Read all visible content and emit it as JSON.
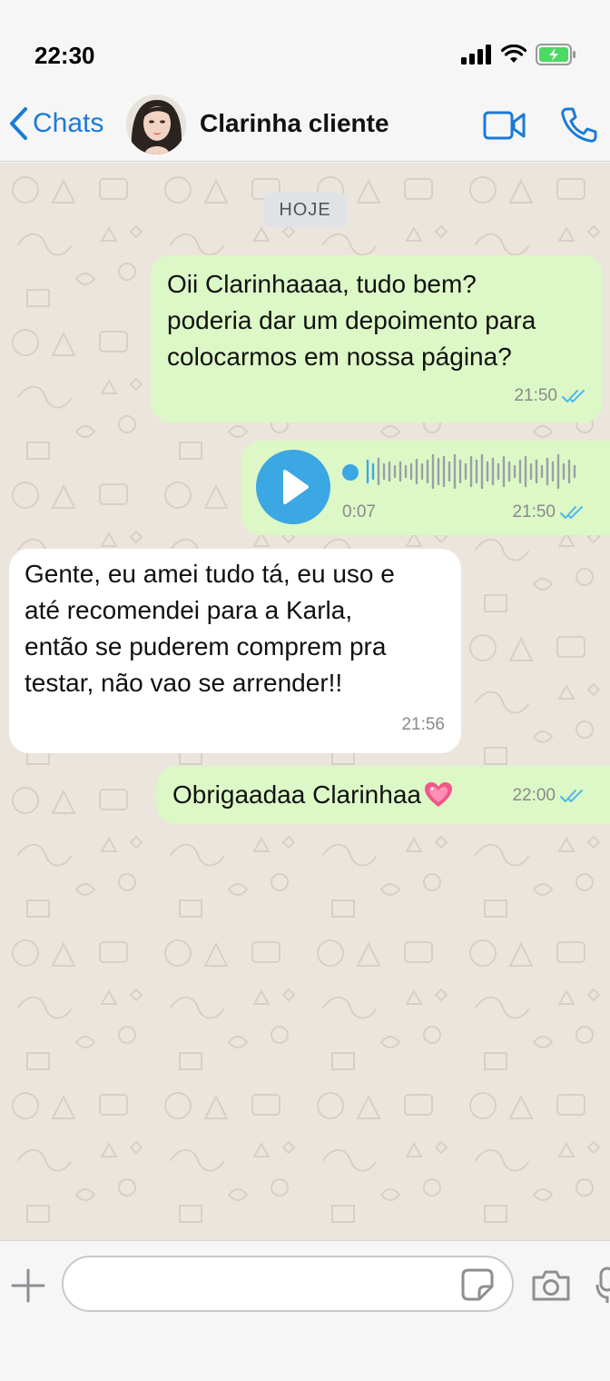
{
  "status_bar": {
    "time": "22:30",
    "icons": [
      "signal-icon",
      "wifi-icon",
      "battery-charging-icon"
    ]
  },
  "header": {
    "back_label": "Chats",
    "contact_name": "Clarinha cliente",
    "icons": [
      "chevron-left-icon",
      "avatar",
      "video-call-icon",
      "phone-call-icon"
    ]
  },
  "chat": {
    "day_label": "HOJE",
    "messages": [
      {
        "direction": "outgoing",
        "lines": [
          "Oii Clarinhaaaa, tudo bem?",
          "poderia dar um depoimento para",
          "colocarmos em nossa página?"
        ],
        "time": "21:50",
        "status": "read-double-check"
      },
      {
        "direction": "outgoing",
        "type": "voice",
        "duration": "0:07",
        "time": "21:50",
        "status": "read-double-check"
      },
      {
        "direction": "incoming",
        "lines": [
          "Gente, eu amei tudo tá, eu uso e",
          "até recomendei para a Karla,",
          "então se puderem comprem pra",
          "testar, não vao se arrender!!"
        ],
        "time": "21:56"
      },
      {
        "direction": "outgoing",
        "text": "Obrigaadaa Clarinhaa",
        "emoji": "sparkling-heart-icon",
        "time": "22:00",
        "status": "read-double-check"
      }
    ]
  },
  "input_bar": {
    "placeholder": "",
    "icons": [
      "plus-icon",
      "sticker-icon",
      "camera-icon",
      "microphone-icon"
    ]
  },
  "colors": {
    "accent": "#1a7bd6",
    "outgoing_bubble": "#dcf8c6",
    "incoming_bubble": "#ffffff",
    "chat_background": "#ece5dd",
    "read_ticks": "#4fb6ec",
    "voice_blue": "#3ba7e3"
  }
}
